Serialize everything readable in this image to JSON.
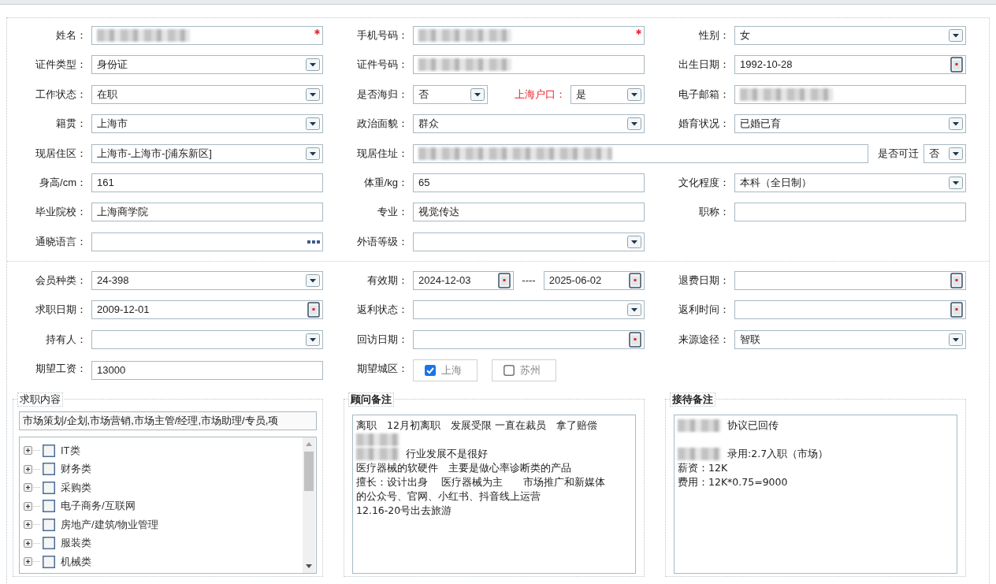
{
  "sections": [
    {
      "rows": [
        [
          {
            "label": "姓名：",
            "controls": [
              {
                "kind": "text",
                "redacted": true,
                "required": true
              }
            ]
          },
          {
            "label": "手机号码：",
            "controls": [
              {
                "kind": "text",
                "redacted": true,
                "required": true
              }
            ]
          },
          {
            "label": "性别：",
            "controls": [
              {
                "kind": "select",
                "value": "女"
              }
            ]
          }
        ],
        [
          {
            "label": "证件类型：",
            "controls": [
              {
                "kind": "select",
                "value": "身份证"
              }
            ]
          },
          {
            "label": "证件号码：",
            "controls": [
              {
                "kind": "text",
                "redacted": true
              }
            ]
          },
          {
            "label": "出生日期：",
            "controls": [
              {
                "kind": "date",
                "value": "1992-10-28"
              }
            ]
          }
        ],
        [
          {
            "label": "工作状态：",
            "controls": [
              {
                "kind": "select",
                "value": "在职"
              }
            ]
          },
          {
            "label": "是否海归：",
            "controls": [
              {
                "kind": "select",
                "value": "否"
              },
              {
                "kind": "label",
                "text": "上海户口：",
                "alert": true
              },
              {
                "kind": "select",
                "value": "是"
              }
            ]
          },
          {
            "label": "电子邮箱：",
            "controls": [
              {
                "kind": "text",
                "redacted": true
              }
            ]
          }
        ],
        [
          {
            "label": "籍贯：",
            "controls": [
              {
                "kind": "select",
                "value": "上海市"
              }
            ]
          },
          {
            "label": "政治面貌：",
            "controls": [
              {
                "kind": "select",
                "value": "群众"
              }
            ]
          },
          {
            "label": "婚育状况：",
            "controls": [
              {
                "kind": "select",
                "value": "已婚已育"
              }
            ]
          }
        ],
        [
          {
            "label": "现居住区：",
            "controls": [
              {
                "kind": "select",
                "value": "上海市-上海市-[浦东新区]"
              }
            ]
          },
          {
            "label": "现居住址：",
            "wide": true,
            "controls": [
              {
                "kind": "text",
                "redacted": true
              },
              {
                "kind": "label",
                "text": "是否可迁",
                "alert": false
              },
              {
                "kind": "select",
                "value": "否"
              }
            ]
          }
        ],
        [
          {
            "label": "身高/cm：",
            "controls": [
              {
                "kind": "text",
                "value": "161"
              }
            ]
          },
          {
            "label": "体重/kg：",
            "controls": [
              {
                "kind": "text",
                "value": "65"
              }
            ]
          },
          {
            "label": "文化程度：",
            "controls": [
              {
                "kind": "select",
                "value": "本科（全日制）"
              }
            ]
          }
        ],
        [
          {
            "label": "毕业院校：",
            "controls": [
              {
                "kind": "text",
                "value": "上海商学院"
              }
            ]
          },
          {
            "label": "专业：",
            "controls": [
              {
                "kind": "text",
                "value": "视觉传达"
              }
            ]
          },
          {
            "label": "职称：",
            "controls": [
              {
                "kind": "text"
              }
            ]
          }
        ],
        [
          {
            "label": "通晓语言：",
            "controls": [
              {
                "kind": "picker"
              }
            ]
          },
          {
            "label": "外语等级：",
            "controls": [
              {
                "kind": "select"
              }
            ]
          }
        ]
      ]
    },
    {
      "rows": [
        [
          {
            "label": "会员种类：",
            "controls": [
              {
                "kind": "select",
                "value": "24-398"
              }
            ]
          },
          {
            "label": "有效期：",
            "controls": [
              {
                "kind": "date",
                "value": "2024-12-03"
              },
              {
                "kind": "sep",
                "text": "----"
              },
              {
                "kind": "date",
                "value": "2025-06-02"
              }
            ]
          },
          {
            "label": "退费日期：",
            "controls": [
              {
                "kind": "date"
              }
            ]
          }
        ],
        [
          {
            "label": "求职日期：",
            "controls": [
              {
                "kind": "date",
                "value": "2009-12-01"
              }
            ]
          },
          {
            "label": "返利状态：",
            "controls": [
              {
                "kind": "select"
              }
            ]
          },
          {
            "label": "返利时间：",
            "controls": [
              {
                "kind": "date"
              }
            ]
          }
        ],
        [
          {
            "label": "持有人：",
            "controls": [
              {
                "kind": "select"
              }
            ]
          },
          {
            "label": "回访日期：",
            "controls": [
              {
                "kind": "date"
              }
            ]
          },
          {
            "label": "来源途径：",
            "controls": [
              {
                "kind": "select",
                "value": "智联"
              }
            ]
          }
        ],
        [
          {
            "label": "期望工资：",
            "controls": [
              {
                "kind": "text",
                "value": "13000"
              }
            ]
          },
          {
            "label": "期望城区：",
            "controls": [
              {
                "kind": "checkbox",
                "text": "上海",
                "checked": true
              },
              {
                "kind": "checkbox",
                "text": "苏州",
                "checked": false
              }
            ]
          }
        ]
      ]
    }
  ],
  "job_content": {
    "title": "求职内容",
    "selection": "市场策划/企划,市场营销,市场主管/经理,市场助理/专员,项",
    "tree": [
      {
        "label": "IT类",
        "expanded": false,
        "checked": false
      },
      {
        "label": "财务类",
        "expanded": false,
        "checked": false
      },
      {
        "label": "采购类",
        "expanded": false,
        "checked": false
      },
      {
        "label": "电子商务/互联网",
        "expanded": false,
        "checked": false
      },
      {
        "label": "房地产/建筑/物业管理",
        "expanded": false,
        "checked": false
      },
      {
        "label": "服装类",
        "expanded": false,
        "checked": false
      },
      {
        "label": "机械类",
        "expanded": false,
        "checked": false
      }
    ]
  },
  "notes": [
    {
      "title": "顾问备注",
      "lines": [
        {
          "kind": "text",
          "text": "离职　12月初离职　发展受限 一直在裁员　拿了赔偿"
        },
        {
          "kind": "blur"
        },
        {
          "kind": "blur_text",
          "text": "行业发展不是很好"
        },
        {
          "kind": "text",
          "text": "医疗器械的软硬件　主要是做心率诊断类的产品"
        },
        {
          "kind": "text",
          "text": "擅长：设计出身　 医疗器械为主　　市场推广和新媒体"
        },
        {
          "kind": "text",
          "text": "的公众号、官网、小红书、抖音线上运营"
        },
        {
          "kind": "text",
          "text": "12.16-20号出去旅游"
        }
      ]
    },
    {
      "title": "接待备注",
      "lines": [
        {
          "kind": "blur_text",
          "text": "协议已回传"
        },
        {
          "kind": "blank"
        },
        {
          "kind": "blur_text",
          "text": "录用:2.7入职（市场）"
        },
        {
          "kind": "text",
          "text": "薪资：12K"
        },
        {
          "kind": "text",
          "text": "费用：12K*0.75=9000"
        }
      ]
    }
  ]
}
